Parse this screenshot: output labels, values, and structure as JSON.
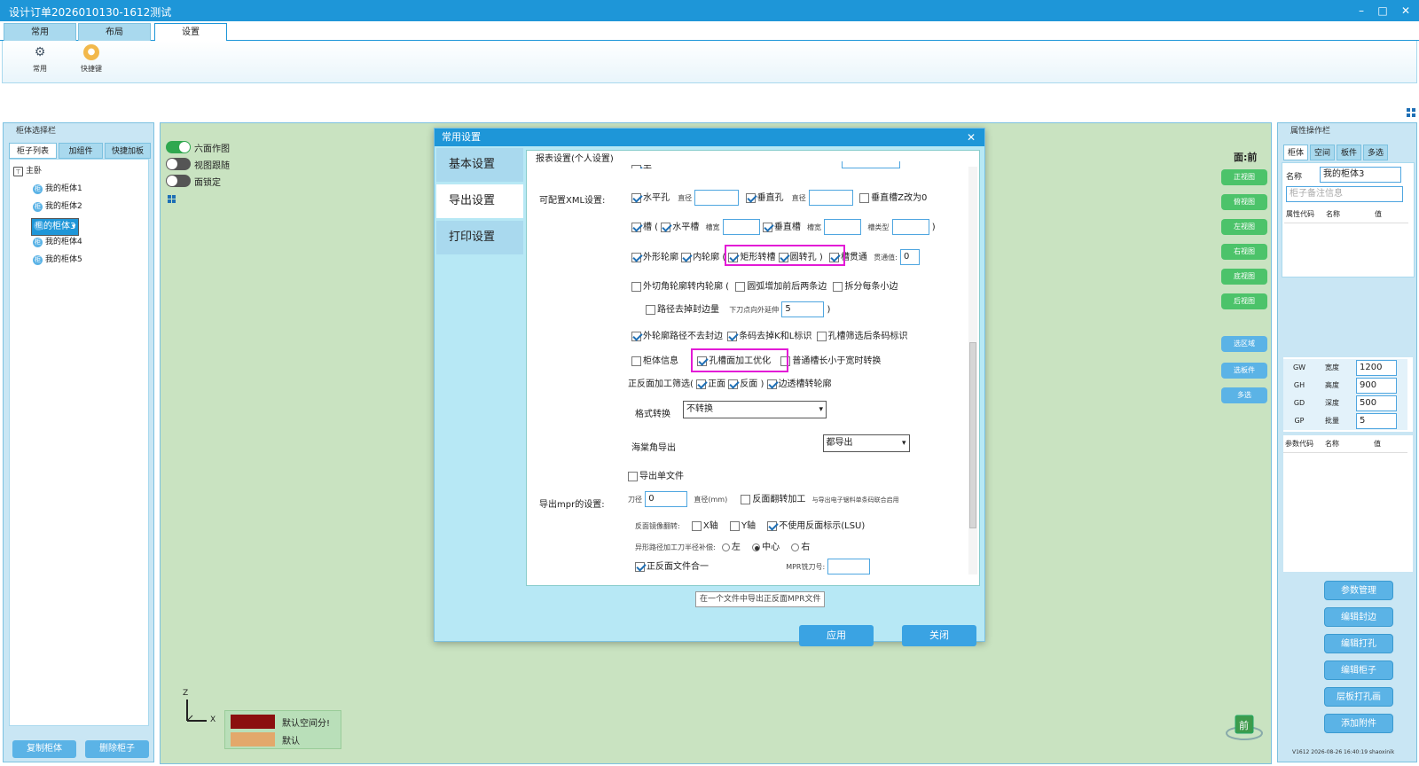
{
  "window": {
    "title": "设计订单2026010130-1612测试",
    "min": "–",
    "max": "□",
    "close": "✕"
  },
  "tabs": [
    "常用",
    "布局",
    "设置"
  ],
  "ribbon": {
    "items": [
      {
        "label": "常用",
        "icon": "gear-icon"
      },
      {
        "label": "快捷键",
        "icon": "shortcut-icon"
      }
    ]
  },
  "left_panel": {
    "title": "柜体选择栏",
    "tabs": [
      "柜子列表",
      "加组件",
      "快捷加板"
    ],
    "tree_root": "主卧",
    "cabinets": [
      "我的柜体1",
      "我的柜体2",
      "我的柜体3",
      "我的柜体4",
      "我的柜体5"
    ],
    "selected": "我的柜体3",
    "copy_btn": "复制柜体",
    "delete_btn": "删除柜子"
  },
  "viewport": {
    "toggles": [
      {
        "label": "六面作图",
        "on": true
      },
      {
        "label": "视图跟随",
        "on": false
      },
      {
        "label": "面锁定",
        "on": false
      }
    ],
    "face_label": "面:前",
    "views": [
      "正视图",
      "俯视图",
      "左视图",
      "右视图",
      "底视图",
      "后视图"
    ],
    "selects": [
      "选区域",
      "选板件",
      "多选"
    ],
    "axes": {
      "z": "Z",
      "x": "X"
    },
    "legend": [
      {
        "label": "默认空间分!",
        "color": "#8b0f0f"
      },
      {
        "label": "默认",
        "color": "#e3a86b"
      }
    ],
    "cube_label": "前"
  },
  "right_panel": {
    "title": "属性操作栏",
    "tabs": [
      "柜体",
      "空间",
      "板件",
      "多选"
    ],
    "name_label": "名称",
    "name_value": "我的柜体3",
    "remark_placeholder": "柜子备注信息",
    "attr_headers": [
      "属性代码",
      "名称",
      "值"
    ],
    "attrs": [
      {
        "code": "GW",
        "name": "宽度",
        "value": "1200"
      },
      {
        "code": "GH",
        "name": "高度",
        "value": "900"
      },
      {
        "code": "GD",
        "name": "深度",
        "value": "500"
      },
      {
        "code": "GP",
        "name": "批量",
        "value": "5"
      }
    ],
    "param_headers": [
      "参数代码",
      "名称",
      "值"
    ],
    "buttons": [
      "参数管理",
      "编辑封边",
      "编辑打孔",
      "编辑柜子",
      "层板打孔画",
      "添加附件"
    ],
    "version": "V1612 2026-08-26 16:40:19 shaoxinik"
  },
  "dialog": {
    "title": "常用设置",
    "close": "✕",
    "nav": [
      "基本设置",
      "导出设置",
      "打印设置"
    ],
    "active_nav": "导出设置",
    "section_top": "报表设置(个人设置)",
    "partial_top": "无",
    "xml_label": "可配置XML设置:",
    "row1": [
      {
        "label": "水平孔",
        "checked": true
      },
      {
        "label": "垂直孔",
        "checked": true
      },
      {
        "label": "垂直槽Z改为0",
        "checked": false
      }
    ],
    "dia": "直径",
    "row2": [
      {
        "label": "槽",
        "checked": true
      },
      {
        "label": "水平槽",
        "checked": true
      },
      {
        "label": "垂直槽",
        "checked": true
      }
    ],
    "slot_w": "槽宽",
    "slot_t": "槽类型",
    "row3": [
      {
        "label": "外形轮廓",
        "checked": true
      },
      {
        "label": "内轮廓",
        "checked": true
      },
      {
        "label": "矩形转槽",
        "checked": true
      },
      {
        "label": "圆转孔",
        "checked": true
      },
      {
        "label": "槽贯通",
        "checked": true
      }
    ],
    "through": "贯通值:",
    "through_val": "0",
    "row4": [
      {
        "label": "外切角轮廓转内轮廓",
        "checked": false
      },
      {
        "label": "圆弧增加前后两条边",
        "checked": false
      },
      {
        "label": "拆分每条小边",
        "checked": false
      }
    ],
    "row5": {
      "label": "路径去掉封边量",
      "checked": false,
      "ext_label": "下刀点向外延伸",
      "ext_val": "5"
    },
    "row6": [
      {
        "label": "外轮廓路径不去封边",
        "checked": true
      },
      {
        "label": "条码去掉K和L标识",
        "checked": true
      },
      {
        "label": "孔槽筛选后条码标识",
        "checked": false
      }
    ],
    "row7": [
      {
        "label": "柜体信息",
        "checked": false
      },
      {
        "label": "孔槽面加工优化",
        "checked": true
      },
      {
        "label": "普通槽长小于宽时转换",
        "checked": false
      }
    ],
    "row8": {
      "label": "正反面加工筛选(",
      "items": [
        {
          "label": "正面",
          "checked": true
        },
        {
          "label": "反面",
          "checked": true
        },
        {
          "label": "边透槽转轮廓",
          "checked": true
        }
      ]
    },
    "format_label": "格式转换",
    "format_val": "不转换",
    "sea_label": "海棠角导出",
    "sea_val": "都导出",
    "single_file": {
      "label": "导出单文件",
      "checked": false
    },
    "mpr_label": "导出mpr的设置:",
    "knife": "刀径",
    "knife_val": "0",
    "knife_unit": "直径(mm)",
    "flip": {
      "label": "反面翻转加工",
      "checked": false
    },
    "flip_note": "与导出电子锯料单条码联合启用",
    "mirror_label": "反面镜像翻转:",
    "mirror": [
      {
        "label": "X轴",
        "checked": false
      },
      {
        "label": "Y轴",
        "checked": false
      },
      {
        "label": "不使用反面标示(LSU)",
        "checked": true
      }
    ],
    "comp_label": "异形路径加工刀半径补偿:",
    "comp": [
      {
        "label": "左",
        "on": false
      },
      {
        "label": "中心",
        "on": true
      },
      {
        "label": "右",
        "on": false
      }
    ],
    "merge": {
      "label": "正反面文件合一",
      "checked": true
    },
    "mpr_knife": "MPR铣刀号:",
    "tooltip": "在一个文件中导出正反面MPR文件",
    "apply": "应用",
    "close_btn": "关闭"
  },
  "colors": {
    "accent": "#1e96d8",
    "highlight": "#e31ad6",
    "viewport_bg": "#c9e3c1"
  }
}
